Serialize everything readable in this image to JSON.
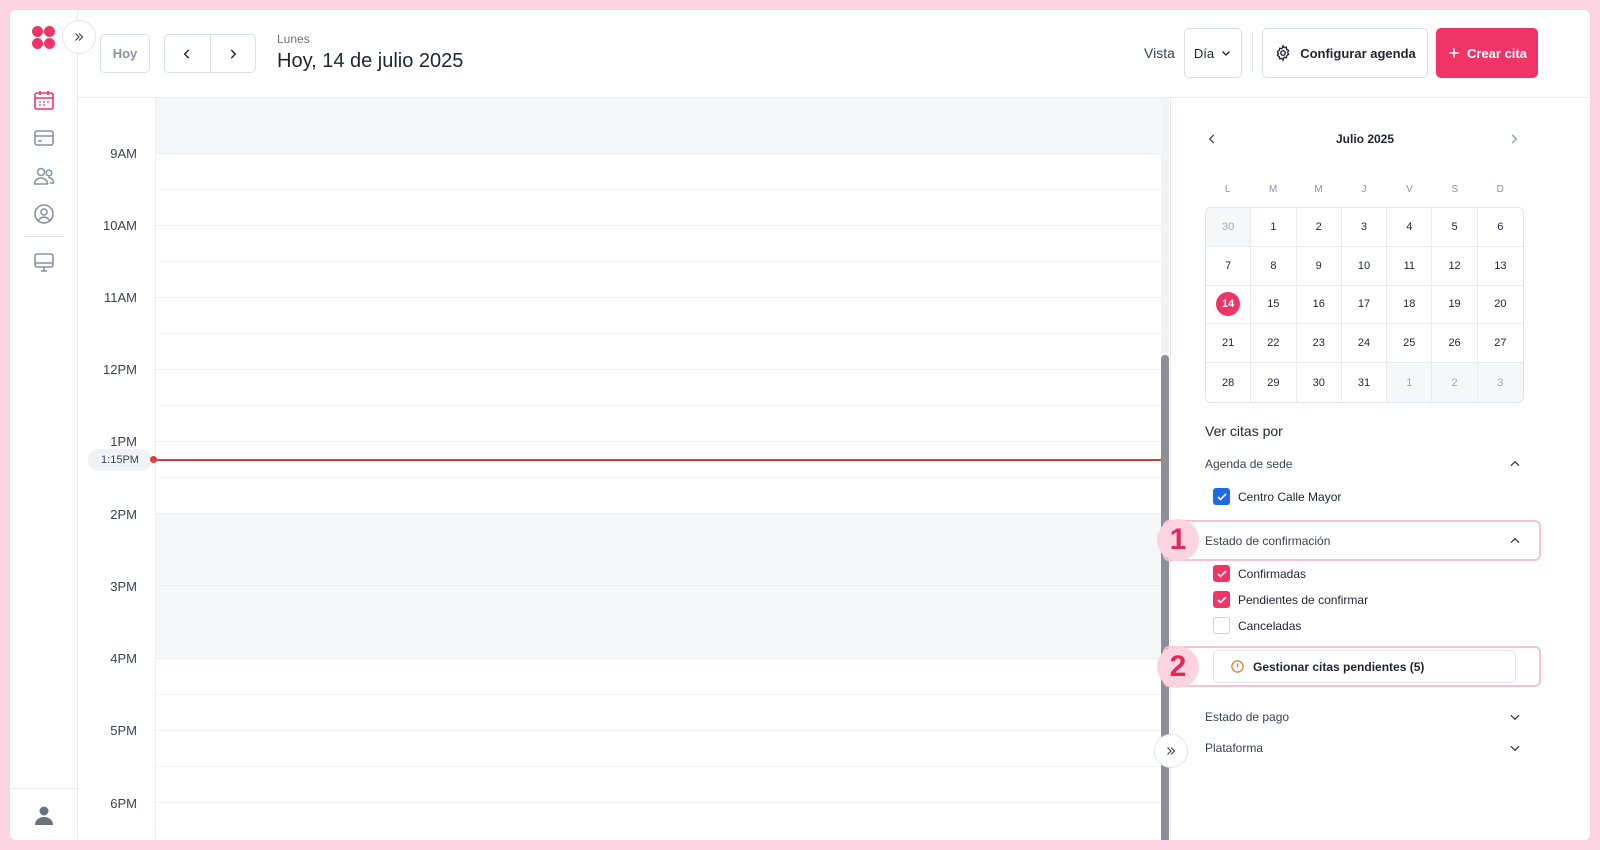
{
  "header": {
    "today_label": "Hoy",
    "weekday": "Lunes",
    "date_title": "Hoy, 14 de julio 2025",
    "view_label": "Vista",
    "view_value": "Día",
    "config_label": "Configurar agenda",
    "create_label": "Crear cita"
  },
  "grid": {
    "hours": [
      "9AM",
      "10AM",
      "11AM",
      "12PM",
      "1PM",
      "2PM",
      "3PM",
      "4PM",
      "5PM",
      "6PM"
    ],
    "now_label": "1:15PM"
  },
  "mini_calendar": {
    "title": "Julio 2025",
    "weekdays": [
      "L",
      "M",
      "M",
      "J",
      "V",
      "S",
      "D"
    ],
    "days": [
      {
        "n": "30",
        "other": true
      },
      {
        "n": "1"
      },
      {
        "n": "2"
      },
      {
        "n": "3"
      },
      {
        "n": "4"
      },
      {
        "n": "5"
      },
      {
        "n": "6"
      },
      {
        "n": "7"
      },
      {
        "n": "8"
      },
      {
        "n": "9"
      },
      {
        "n": "10"
      },
      {
        "n": "11"
      },
      {
        "n": "12"
      },
      {
        "n": "13"
      },
      {
        "n": "14",
        "today": true
      },
      {
        "n": "15"
      },
      {
        "n": "16"
      },
      {
        "n": "17"
      },
      {
        "n": "18"
      },
      {
        "n": "19"
      },
      {
        "n": "20"
      },
      {
        "n": "21"
      },
      {
        "n": "22"
      },
      {
        "n": "23"
      },
      {
        "n": "24"
      },
      {
        "n": "25"
      },
      {
        "n": "26"
      },
      {
        "n": "27"
      },
      {
        "n": "28"
      },
      {
        "n": "29"
      },
      {
        "n": "30"
      },
      {
        "n": "31"
      },
      {
        "n": "1",
        "other": true
      },
      {
        "n": "2",
        "other": true
      },
      {
        "n": "3",
        "other": true
      }
    ]
  },
  "filters": {
    "title": "Ver citas por",
    "agenda": {
      "label": "Agenda de sede",
      "options": [
        {
          "label": "Centro Calle Mayor",
          "checked": true
        }
      ]
    },
    "confirmation": {
      "label": "Estado de confirmación",
      "options": [
        {
          "label": "Confirmadas",
          "checked": true
        },
        {
          "label": "Pendientes de confirmar",
          "checked": true
        },
        {
          "label": "Canceladas",
          "checked": false
        }
      ]
    },
    "manage_pending_label": "Gestionar citas pendientes (5)",
    "payment": {
      "label": "Estado de pago"
    },
    "platform": {
      "label": "Plataforma"
    }
  },
  "annotations": [
    "1",
    "2"
  ],
  "colors": {
    "brand": "#f03468",
    "now_line": "#d93a3a",
    "check_blue": "#1d6ae5",
    "highlight": "#fbd3e1"
  }
}
